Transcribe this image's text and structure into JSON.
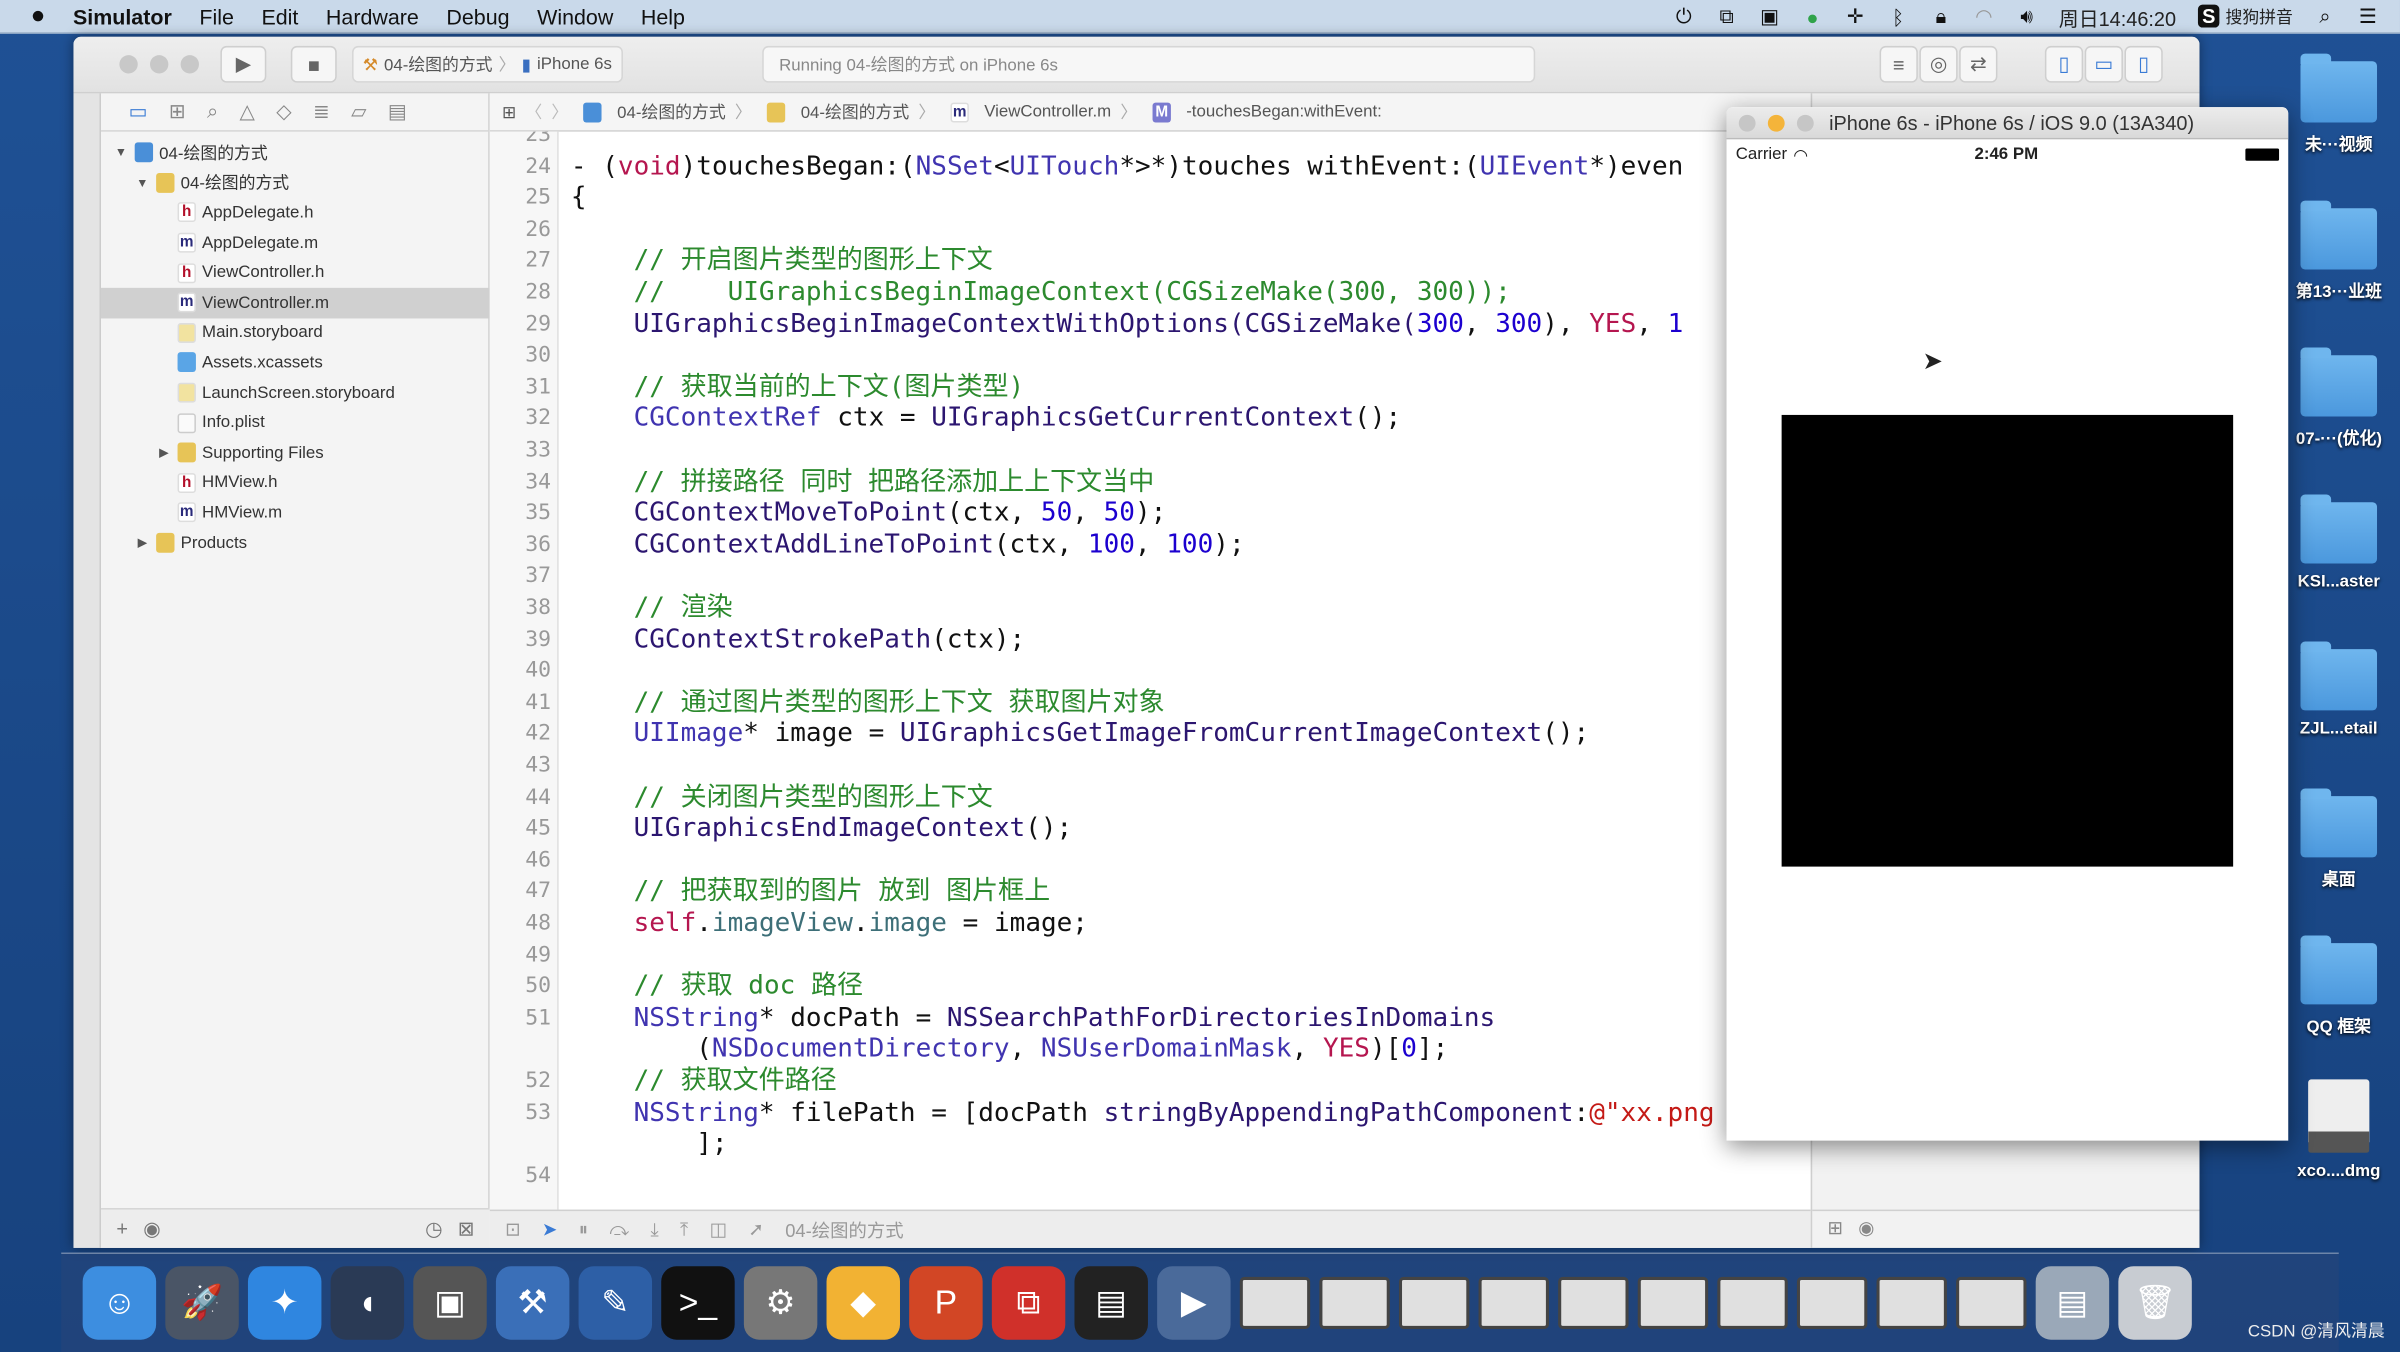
{
  "menubar": {
    "app": "Simulator",
    "items": [
      "File",
      "Edit",
      "Hardware",
      "Debug",
      "Window",
      "Help"
    ],
    "clock": "周日14:46:20",
    "ime": "搜狗拼音"
  },
  "toolbar": {
    "scheme_project": "04-绘图的方式",
    "scheme_device": "iPhone 6s",
    "activity": "Running 04-绘图的方式 on iPhone 6s"
  },
  "navigator": {
    "items": [
      {
        "label": "04-绘图的方式",
        "icon": "fi-proj",
        "depth": 0,
        "tri": "▼"
      },
      {
        "label": "04-绘图的方式",
        "icon": "fi-folder",
        "depth": 1,
        "tri": "▼"
      },
      {
        "label": "AppDelegate.h",
        "icon": "fi-h",
        "depth": 2,
        "glyph": "h"
      },
      {
        "label": "AppDelegate.m",
        "icon": "fi-m",
        "depth": 2,
        "glyph": "m"
      },
      {
        "label": "ViewController.h",
        "icon": "fi-h",
        "depth": 2,
        "glyph": "h"
      },
      {
        "label": "ViewController.m",
        "icon": "fi-m",
        "depth": 2,
        "glyph": "m",
        "selected": true
      },
      {
        "label": "Main.storyboard",
        "icon": "fi-sb",
        "depth": 2
      },
      {
        "label": "Assets.xcassets",
        "icon": "fi-assets",
        "depth": 2
      },
      {
        "label": "LaunchScreen.storyboard",
        "icon": "fi-sb",
        "depth": 2
      },
      {
        "label": "Info.plist",
        "icon": "fi-plist",
        "depth": 2
      },
      {
        "label": "Supporting Files",
        "icon": "fi-folder",
        "depth": 2,
        "tri": "▶"
      },
      {
        "label": "HMView.h",
        "icon": "fi-h",
        "depth": 2,
        "glyph": "h"
      },
      {
        "label": "HMView.m",
        "icon": "fi-m",
        "depth": 2,
        "glyph": "m"
      },
      {
        "label": "Products",
        "icon": "fi-folder",
        "depth": 1,
        "tri": "▶"
      }
    ]
  },
  "jumpbar": {
    "project": "04-绘图的方式",
    "group": "04-绘图的方式",
    "file": "ViewController.m",
    "method": "-touchesBegan:withEvent:"
  },
  "code": [
    {
      "n": "23",
      "t": []
    },
    {
      "n": "24",
      "t": [
        [
          "plain",
          "- ("
        ],
        [
          "kw",
          "void"
        ],
        [
          "plain",
          ")touchesBegan:("
        ],
        [
          "type",
          "NSSet"
        ],
        [
          "plain",
          "<"
        ],
        [
          "type",
          "UITouch"
        ],
        [
          "plain",
          "*>*)touches withEvent:("
        ],
        [
          "type",
          "UIEvent"
        ],
        [
          "plain",
          "*)even"
        ]
      ]
    },
    {
      "n": "25",
      "t": [
        [
          "plain",
          "{"
        ]
      ]
    },
    {
      "n": "26",
      "t": []
    },
    {
      "n": "27",
      "t": [
        [
          "comment",
          "    // 开启图片类型的图形上下文"
        ]
      ]
    },
    {
      "n": "28",
      "t": [
        [
          "comment",
          "    //    UIGraphicsBeginImageContext(CGSizeMake(300, 300));"
        ]
      ]
    },
    {
      "n": "29",
      "t": [
        [
          "func",
          "    UIGraphicsBeginImageContextWithOptions(CGSizeMake("
        ],
        [
          "num",
          "300"
        ],
        [
          "plain",
          ", "
        ],
        [
          "num",
          "300"
        ],
        [
          "plain",
          "), "
        ],
        [
          "kw",
          "YES"
        ],
        [
          "plain",
          ", "
        ],
        [
          "num",
          "1"
        ]
      ]
    },
    {
      "n": "30",
      "t": []
    },
    {
      "n": "31",
      "t": [
        [
          "comment",
          "    // 获取当前的上下文(图片类型)"
        ]
      ]
    },
    {
      "n": "32",
      "t": [
        [
          "type",
          "    CGContextRef"
        ],
        [
          "plain",
          " ctx = "
        ],
        [
          "func",
          "UIGraphicsGetCurrentContext"
        ],
        [
          "plain",
          "();"
        ]
      ]
    },
    {
      "n": "33",
      "t": []
    },
    {
      "n": "34",
      "t": [
        [
          "comment",
          "    // 拼接路径 同时 把路径添加上上下文当中"
        ]
      ]
    },
    {
      "n": "35",
      "t": [
        [
          "func",
          "    CGContextMoveToPoint"
        ],
        [
          "plain",
          "(ctx, "
        ],
        [
          "num",
          "50"
        ],
        [
          "plain",
          ", "
        ],
        [
          "num",
          "50"
        ],
        [
          "plain",
          ");"
        ]
      ]
    },
    {
      "n": "36",
      "t": [
        [
          "func",
          "    CGContextAddLineToPoint"
        ],
        [
          "plain",
          "(ctx, "
        ],
        [
          "num",
          "100"
        ],
        [
          "plain",
          ", "
        ],
        [
          "num",
          "100"
        ],
        [
          "plain",
          ");"
        ]
      ]
    },
    {
      "n": "37",
      "t": []
    },
    {
      "n": "38",
      "t": [
        [
          "comment",
          "    // 渲染"
        ]
      ]
    },
    {
      "n": "39",
      "t": [
        [
          "func",
          "    CGContextStrokePath"
        ],
        [
          "plain",
          "(ctx);"
        ]
      ]
    },
    {
      "n": "40",
      "t": []
    },
    {
      "n": "41",
      "t": [
        [
          "comment",
          "    // 通过图片类型的图形上下文 获取图片对象"
        ]
      ]
    },
    {
      "n": "42",
      "t": [
        [
          "type",
          "    UIImage"
        ],
        [
          "plain",
          "* image = "
        ],
        [
          "func",
          "UIGraphicsGetImageFromCurrentImageContext"
        ],
        [
          "plain",
          "();"
        ]
      ]
    },
    {
      "n": "43",
      "t": []
    },
    {
      "n": "44",
      "t": [
        [
          "comment",
          "    // 关闭图片类型的图形上下文"
        ]
      ]
    },
    {
      "n": "45",
      "t": [
        [
          "func",
          "    UIGraphicsEndImageContext"
        ],
        [
          "plain",
          "();"
        ]
      ]
    },
    {
      "n": "46",
      "t": []
    },
    {
      "n": "47",
      "t": [
        [
          "comment",
          "    // 把获取到的图片 放到 图片框上"
        ]
      ]
    },
    {
      "n": "48",
      "t": [
        [
          "kw",
          "    self"
        ],
        [
          "plain",
          "."
        ],
        [
          "prop",
          "imageView"
        ],
        [
          "plain",
          "."
        ],
        [
          "prop",
          "image"
        ],
        [
          "plain",
          " = image;"
        ]
      ]
    },
    {
      "n": "49",
      "t": []
    },
    {
      "n": "50",
      "t": [
        [
          "comment",
          "    // 获取 doc 路径"
        ]
      ]
    },
    {
      "n": "51",
      "t": [
        [
          "type",
          "    NSString"
        ],
        [
          "plain",
          "* docPath = "
        ],
        [
          "func",
          "NSSearchPathForDirectoriesInDomains"
        ]
      ]
    },
    {
      "n": "",
      "t": [
        [
          "plain",
          "        ("
        ],
        [
          "type",
          "NSDocumentDirectory"
        ],
        [
          "plain",
          ", "
        ],
        [
          "type",
          "NSUserDomainMask"
        ],
        [
          "plain",
          ", "
        ],
        [
          "kw",
          "YES"
        ],
        [
          "plain",
          ")["
        ],
        [
          "num",
          "0"
        ],
        [
          "plain",
          "];"
        ]
      ]
    },
    {
      "n": "52",
      "t": [
        [
          "comment",
          "    // 获取文件路径"
        ]
      ]
    },
    {
      "n": "53",
      "t": [
        [
          "type",
          "    NSString"
        ],
        [
          "plain",
          "* filePath = [docPath "
        ],
        [
          "func",
          "stringByAppendingPathComponent"
        ],
        [
          "plain",
          ":"
        ],
        [
          "str",
          "@\"xx.png"
        ]
      ]
    },
    {
      "n": "",
      "t": [
        [
          "plain",
          "        ];"
        ]
      ]
    },
    {
      "n": "54",
      "t": []
    }
  ],
  "debugbar": {
    "target": "04-绘图的方式"
  },
  "simulator": {
    "title": "iPhone 6s - iPhone 6s / iOS 9.0 (13A340)",
    "carrier": "Carrier",
    "time": "2:46 PM",
    "image_color": "#000000"
  },
  "desktop": {
    "items": [
      {
        "label": "未···视频",
        "type": "folder"
      },
      {
        "label": "第13···业班",
        "type": "folder"
      },
      {
        "label": "07-···(优化)",
        "type": "folder"
      },
      {
        "label": "KSI...aster",
        "type": "folder"
      },
      {
        "label": "ZJL...etail",
        "type": "folder"
      },
      {
        "label": "桌面",
        "type": "folder"
      },
      {
        "label": "QQ 框架",
        "type": "folder"
      },
      {
        "label": "xco....dmg",
        "type": "disk-image"
      }
    ]
  },
  "dock": {
    "items": [
      {
        "name": "finder",
        "color": "#3d8ee0",
        "glyph": "☺"
      },
      {
        "name": "launchpad",
        "color": "#4a5566",
        "glyph": "🚀"
      },
      {
        "name": "safari",
        "color": "#2f86e0",
        "glyph": "✦"
      },
      {
        "name": "mouse",
        "color": "#2a3a55",
        "glyph": "◖"
      },
      {
        "name": "photo-booth",
        "color": "#555",
        "glyph": "▣"
      },
      {
        "name": "xcode",
        "color": "#3a6fb8",
        "glyph": "⚒"
      },
      {
        "name": "instruments",
        "color": "#2d5fa6",
        "glyph": "✎"
      },
      {
        "name": "terminal",
        "color": "#111",
        "glyph": ">_"
      },
      {
        "name": "system-preferences",
        "color": "#777",
        "glyph": "⚙"
      },
      {
        "name": "sketch",
        "color": "#f2b233",
        "glyph": "◆"
      },
      {
        "name": "powerpoint",
        "color": "#d24625",
        "glyph": "P"
      },
      {
        "name": "parallels",
        "color": "#d0302a",
        "glyph": "⧉"
      },
      {
        "name": "console",
        "color": "#222",
        "glyph": "▤"
      },
      {
        "name": "quicktime",
        "color": "#4a6a9a",
        "glyph": "▶"
      }
    ],
    "windows": 10
  },
  "watermark": "CSDN @清风清晨"
}
